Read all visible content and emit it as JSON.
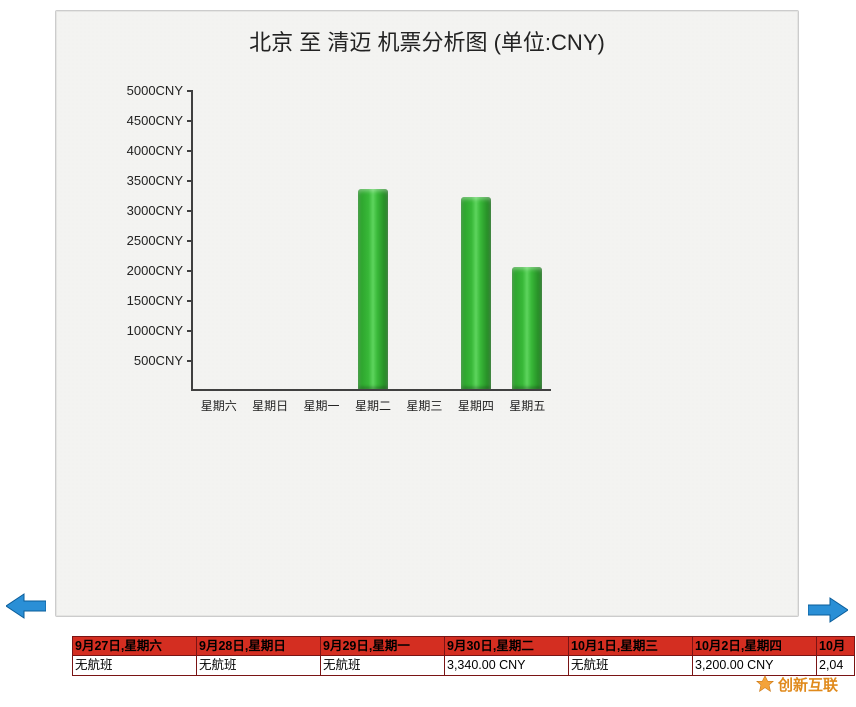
{
  "chart_data": {
    "type": "bar",
    "title": "北京 至 清迈 机票分析图 (单位:CNY)",
    "categories": [
      "星期六",
      "星期日",
      "星期一",
      "星期二",
      "星期三",
      "星期四",
      "星期五"
    ],
    "values": [
      0,
      0,
      0,
      3340,
      0,
      3200,
      2040
    ],
    "xlabel": "",
    "ylabel": "",
    "ylim": [
      0,
      5000
    ],
    "y_ticks": [
      500,
      1000,
      1500,
      2000,
      2500,
      3000,
      3500,
      4000,
      4500,
      5000
    ],
    "y_tick_suffix": "CNY"
  },
  "table": {
    "headers": [
      "9月27日,星期六",
      "9月28日,星期日",
      "9月29日,星期一",
      "9月30日,星期二",
      "10月1日,星期三",
      "10月2日,星期四",
      "10月"
    ],
    "values": [
      "无航班",
      "无航班",
      "无航班",
      "3,340.00 CNY",
      "无航班",
      "3,200.00 CNY",
      "2,04"
    ]
  },
  "watermark": "创新互联"
}
